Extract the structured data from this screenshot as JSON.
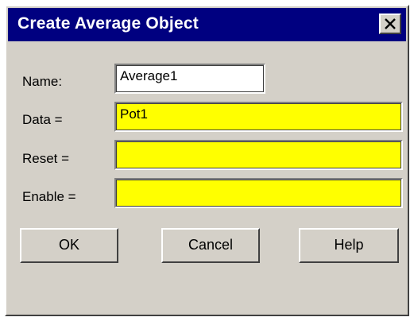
{
  "window": {
    "title": "Create Average Object",
    "close_symbol": "×"
  },
  "form": {
    "name_label": "Name:",
    "name_value": "Average1",
    "data_label": "Data =",
    "data_value": "Pot1",
    "reset_label": "Reset =",
    "reset_value": "",
    "enable_label": "Enable =",
    "enable_value": ""
  },
  "buttons": {
    "ok": "OK",
    "cancel": "Cancel",
    "help": "Help"
  },
  "colors": {
    "titlebar": "#000080",
    "dialog_face": "#d4d0c8",
    "expression_field": "#ffff00",
    "text_field": "#ffffff"
  }
}
